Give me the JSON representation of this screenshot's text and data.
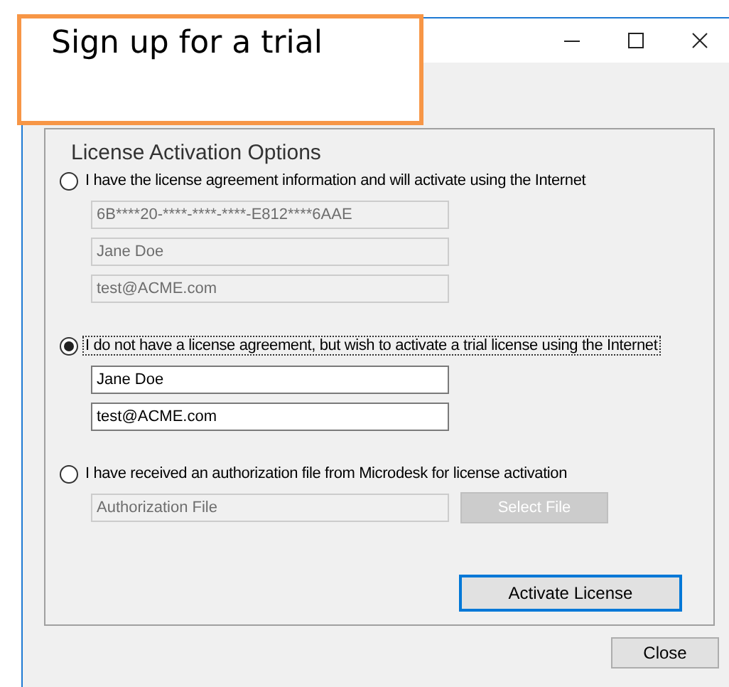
{
  "callout": {
    "text": "Sign up for a trial"
  },
  "group": {
    "title": "License Activation Options"
  },
  "options": [
    {
      "label": "I have the license agreement information and will activate using the Internet",
      "selected": false,
      "focused": false,
      "fields": [
        {
          "value": "6B****20-****-****-****-E812****6AAE",
          "disabled": true
        },
        {
          "value": "Jane Doe",
          "disabled": true
        },
        {
          "value": "test@ACME.com",
          "disabled": true
        }
      ]
    },
    {
      "label": "I do not have a license agreement, but wish to activate a trial license using the Internet",
      "selected": true,
      "focused": true,
      "fields": [
        {
          "value": "Jane Doe",
          "disabled": false
        },
        {
          "value": "test@ACME.com",
          "disabled": false
        }
      ]
    },
    {
      "label": "I have received an authorization file from Microdesk for license activation",
      "selected": false,
      "focused": false,
      "fields": [
        {
          "placeholder": "Authorization File",
          "disabled": true
        }
      ],
      "button": {
        "label": "Select File",
        "disabled": true
      }
    }
  ],
  "activate_button": {
    "label": "Activate License"
  },
  "close_button": {
    "label": "Close"
  }
}
